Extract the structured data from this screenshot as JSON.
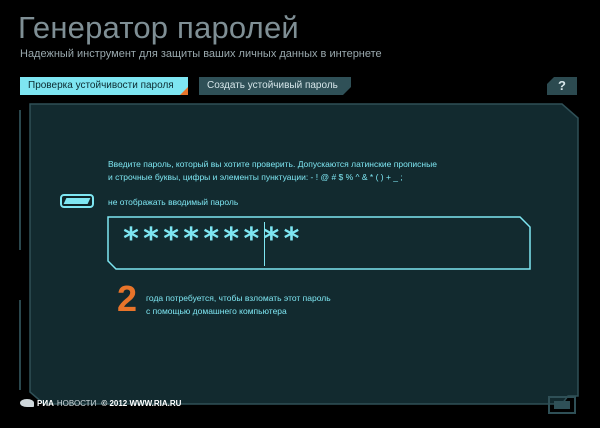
{
  "header": {
    "title": "Генератор паролей",
    "subtitle": "Надежный инструмент для защиты ваших личных данных в интернете"
  },
  "tabs": [
    {
      "label": "Проверка устойчивости пароля",
      "active": true
    },
    {
      "label": "Создать устойчивый пароль",
      "active": false
    }
  ],
  "help": {
    "label": "?"
  },
  "checker": {
    "instructions_line1": "Введите пароль, который вы хотите проверить. Допускаются латинские прописные",
    "instructions_line2": "и строчные буквы, цифры и элементы пунктуации: - ! @ # $ % ^ & * ( ) + _ ;",
    "hide_toggle_label": "не отображать вводимый пароль",
    "password_value": "*********",
    "result_number": "2",
    "result_line1": "года потребуется, чтобы взломать этот пароль",
    "result_line2": "с помощью домашнего компьютера"
  },
  "footer": {
    "brand_bold": "РИА",
    "brand_light": "НОВОСТИ",
    "copyright": "© 2012 WWW.RIA.RU"
  },
  "colors": {
    "accent": "#7ee6f2",
    "orange": "#e8742a",
    "panel": "#122a2f",
    "tab_inactive": "#2f5057",
    "title": "#7f8f95"
  },
  "icons": {
    "help": "question-icon",
    "fullscreen": "fullscreen-icon",
    "logo": "ria-logo-icon"
  }
}
